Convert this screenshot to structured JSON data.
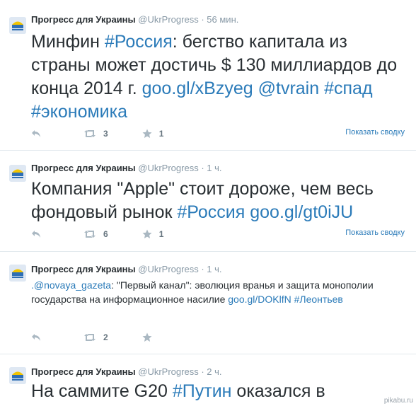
{
  "author": {
    "name": "Прогресс для Украины",
    "handle": "@UkrProgress"
  },
  "tweets": [
    {
      "time": "56 мин.",
      "parts": [
        {
          "t": "Минфин ",
          "link": false
        },
        {
          "t": "#Россия",
          "link": true
        },
        {
          "t": ": бегство капитала из страны может достичь $ 130 миллиардов до конца 2014 г. ",
          "link": false
        },
        {
          "t": "goo.gl/xBzyeg",
          "link": true
        },
        {
          "t": " ",
          "link": false
        },
        {
          "t": "@tvrain",
          "link": true
        },
        {
          "t": " ",
          "link": false
        },
        {
          "t": "#спад",
          "link": true
        },
        {
          "t": " ",
          "link": false
        },
        {
          "t": "#экономика",
          "link": true
        }
      ],
      "retweets": "3",
      "favorites": "1",
      "summary": "Показать сводку"
    },
    {
      "time": "1 ч.",
      "parts": [
        {
          "t": "Компания \"Apple\" стоит дороже, чем весь фондовый рынок ",
          "link": false
        },
        {
          "t": "#Россия",
          "link": true
        },
        {
          "t": " ",
          "link": false
        },
        {
          "t": "goo.gl/gt0iJU",
          "link": true
        }
      ],
      "retweets": "6",
      "favorites": "1",
      "summary": "Показать сводку"
    },
    {
      "time": "1 ч.",
      "parts": [
        {
          "t": ".@novaya_gazeta",
          "link": true
        },
        {
          "t": ": \"Первый канал\": эволюция вранья и защита монополии государства на информационное насилие ",
          "link": false
        },
        {
          "t": "goo.gl/DOKlfN",
          "link": true
        },
        {
          "t": " ",
          "link": false
        },
        {
          "t": "#Леонтьев",
          "link": true
        }
      ],
      "retweets": "2",
      "favorites": ""
    },
    {
      "time": "2 ч.",
      "parts": [
        {
          "t": "На саммите G20 ",
          "link": false
        },
        {
          "t": "#Путин",
          "link": true
        },
        {
          "t": " оказался в",
          "link": false
        }
      ]
    }
  ],
  "watermark": "pikabu.ru",
  "colors": {
    "link": "#2b7bb9",
    "meta": "#8899a6",
    "text": "#292f33"
  },
  "icons": [
    "reply-icon",
    "retweet-icon",
    "favorite-icon",
    "avatar-logo"
  ]
}
